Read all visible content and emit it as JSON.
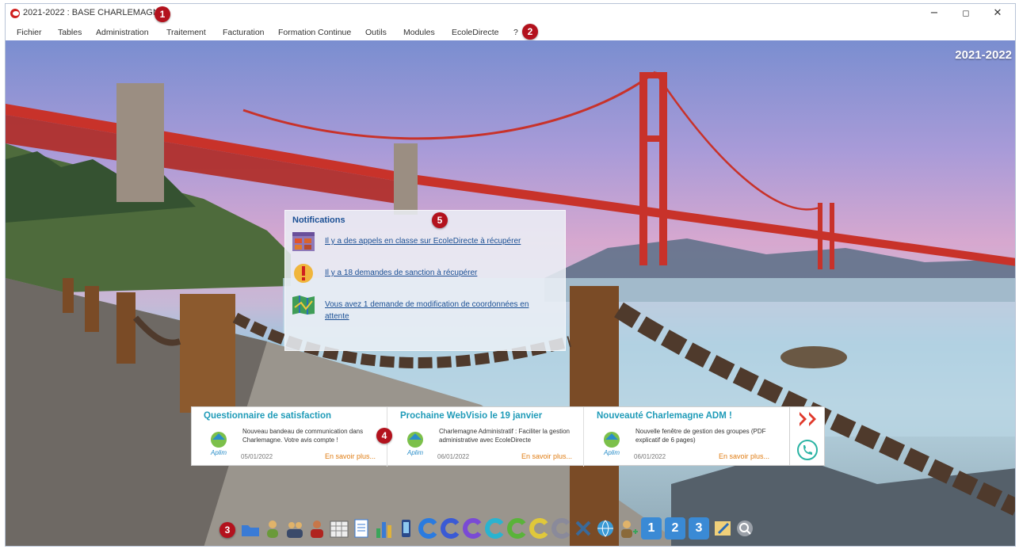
{
  "window": {
    "title": "2021-2022 : BASE CHARLEMAGNE",
    "controls": {
      "minimize": "−",
      "maximize": "◻",
      "close": "✕"
    }
  },
  "menu": [
    "Fichier",
    "Tables",
    "Administration",
    "Traitement",
    "Facturation",
    "Formation Continue",
    "Outils",
    "Modules",
    "EcoleDirecte",
    "?"
  ],
  "desktop": {
    "year_label": "2021-2022"
  },
  "badges": [
    "1",
    "2",
    "3",
    "4",
    "5"
  ],
  "notifications": {
    "title": "Notifications",
    "items": [
      {
        "text": "Il y a des appels en classe sur EcoleDirecte à récupérer",
        "icon": "calendar-grid-icon"
      },
      {
        "text": "Il y a 18 demandes de sanction à récupérer",
        "icon": "warning-exclamation-icon"
      },
      {
        "text": "Vous avez 1 demande de modification de coordonnées en attente",
        "icon": "map-icon"
      }
    ]
  },
  "news": [
    {
      "title": "Questionnaire de satisfaction",
      "desc": "Nouveau bandeau de communication dans Charlemagne. Votre avis compte !",
      "date": "05/01/2022",
      "more": "En savoir plus..."
    },
    {
      "title": "Prochaine WebVisio le 19 janvier",
      "desc": "Charlemagne Administratif : Faciliter la gestion administrative avec EcoleDirecte",
      "date": "06/01/2022",
      "more": "En savoir plus..."
    },
    {
      "title": "Nouveauté Charlemagne ADM !",
      "desc": "Nouvelle fenêtre de gestion des groupes (PDF explicatif de 6 pages)",
      "date": "06/01/2022",
      "more": "En savoir plus..."
    }
  ],
  "news_logo_text": "Aplim",
  "news_side": {
    "next_icon": "double-chevron-right-icon",
    "phone_icon": "phone-icon"
  },
  "dock": {
    "number_labels": [
      "1",
      "2",
      "3"
    ],
    "icons": [
      "folder-icon",
      "user-icon",
      "group-icon",
      "people-icon",
      "calendar-icon",
      "document-icon",
      "bars-icon",
      "phone-device-icon",
      "c-blue-icon",
      "c-blue-icon",
      "c-purple-icon",
      "c-cyan-icon",
      "c-green-icon",
      "c-yellow-icon",
      "c-grey-icon",
      "close-x-icon",
      "globe-icon",
      "user-add-icon",
      "number-1-icon",
      "number-2-icon",
      "number-3-icon",
      "edit-icon",
      "search-icon"
    ]
  },
  "colors": {
    "accent": "#1a4f94",
    "news_title": "#1f9bb8",
    "more_link": "#e07d14",
    "badge": "#b3121d"
  }
}
